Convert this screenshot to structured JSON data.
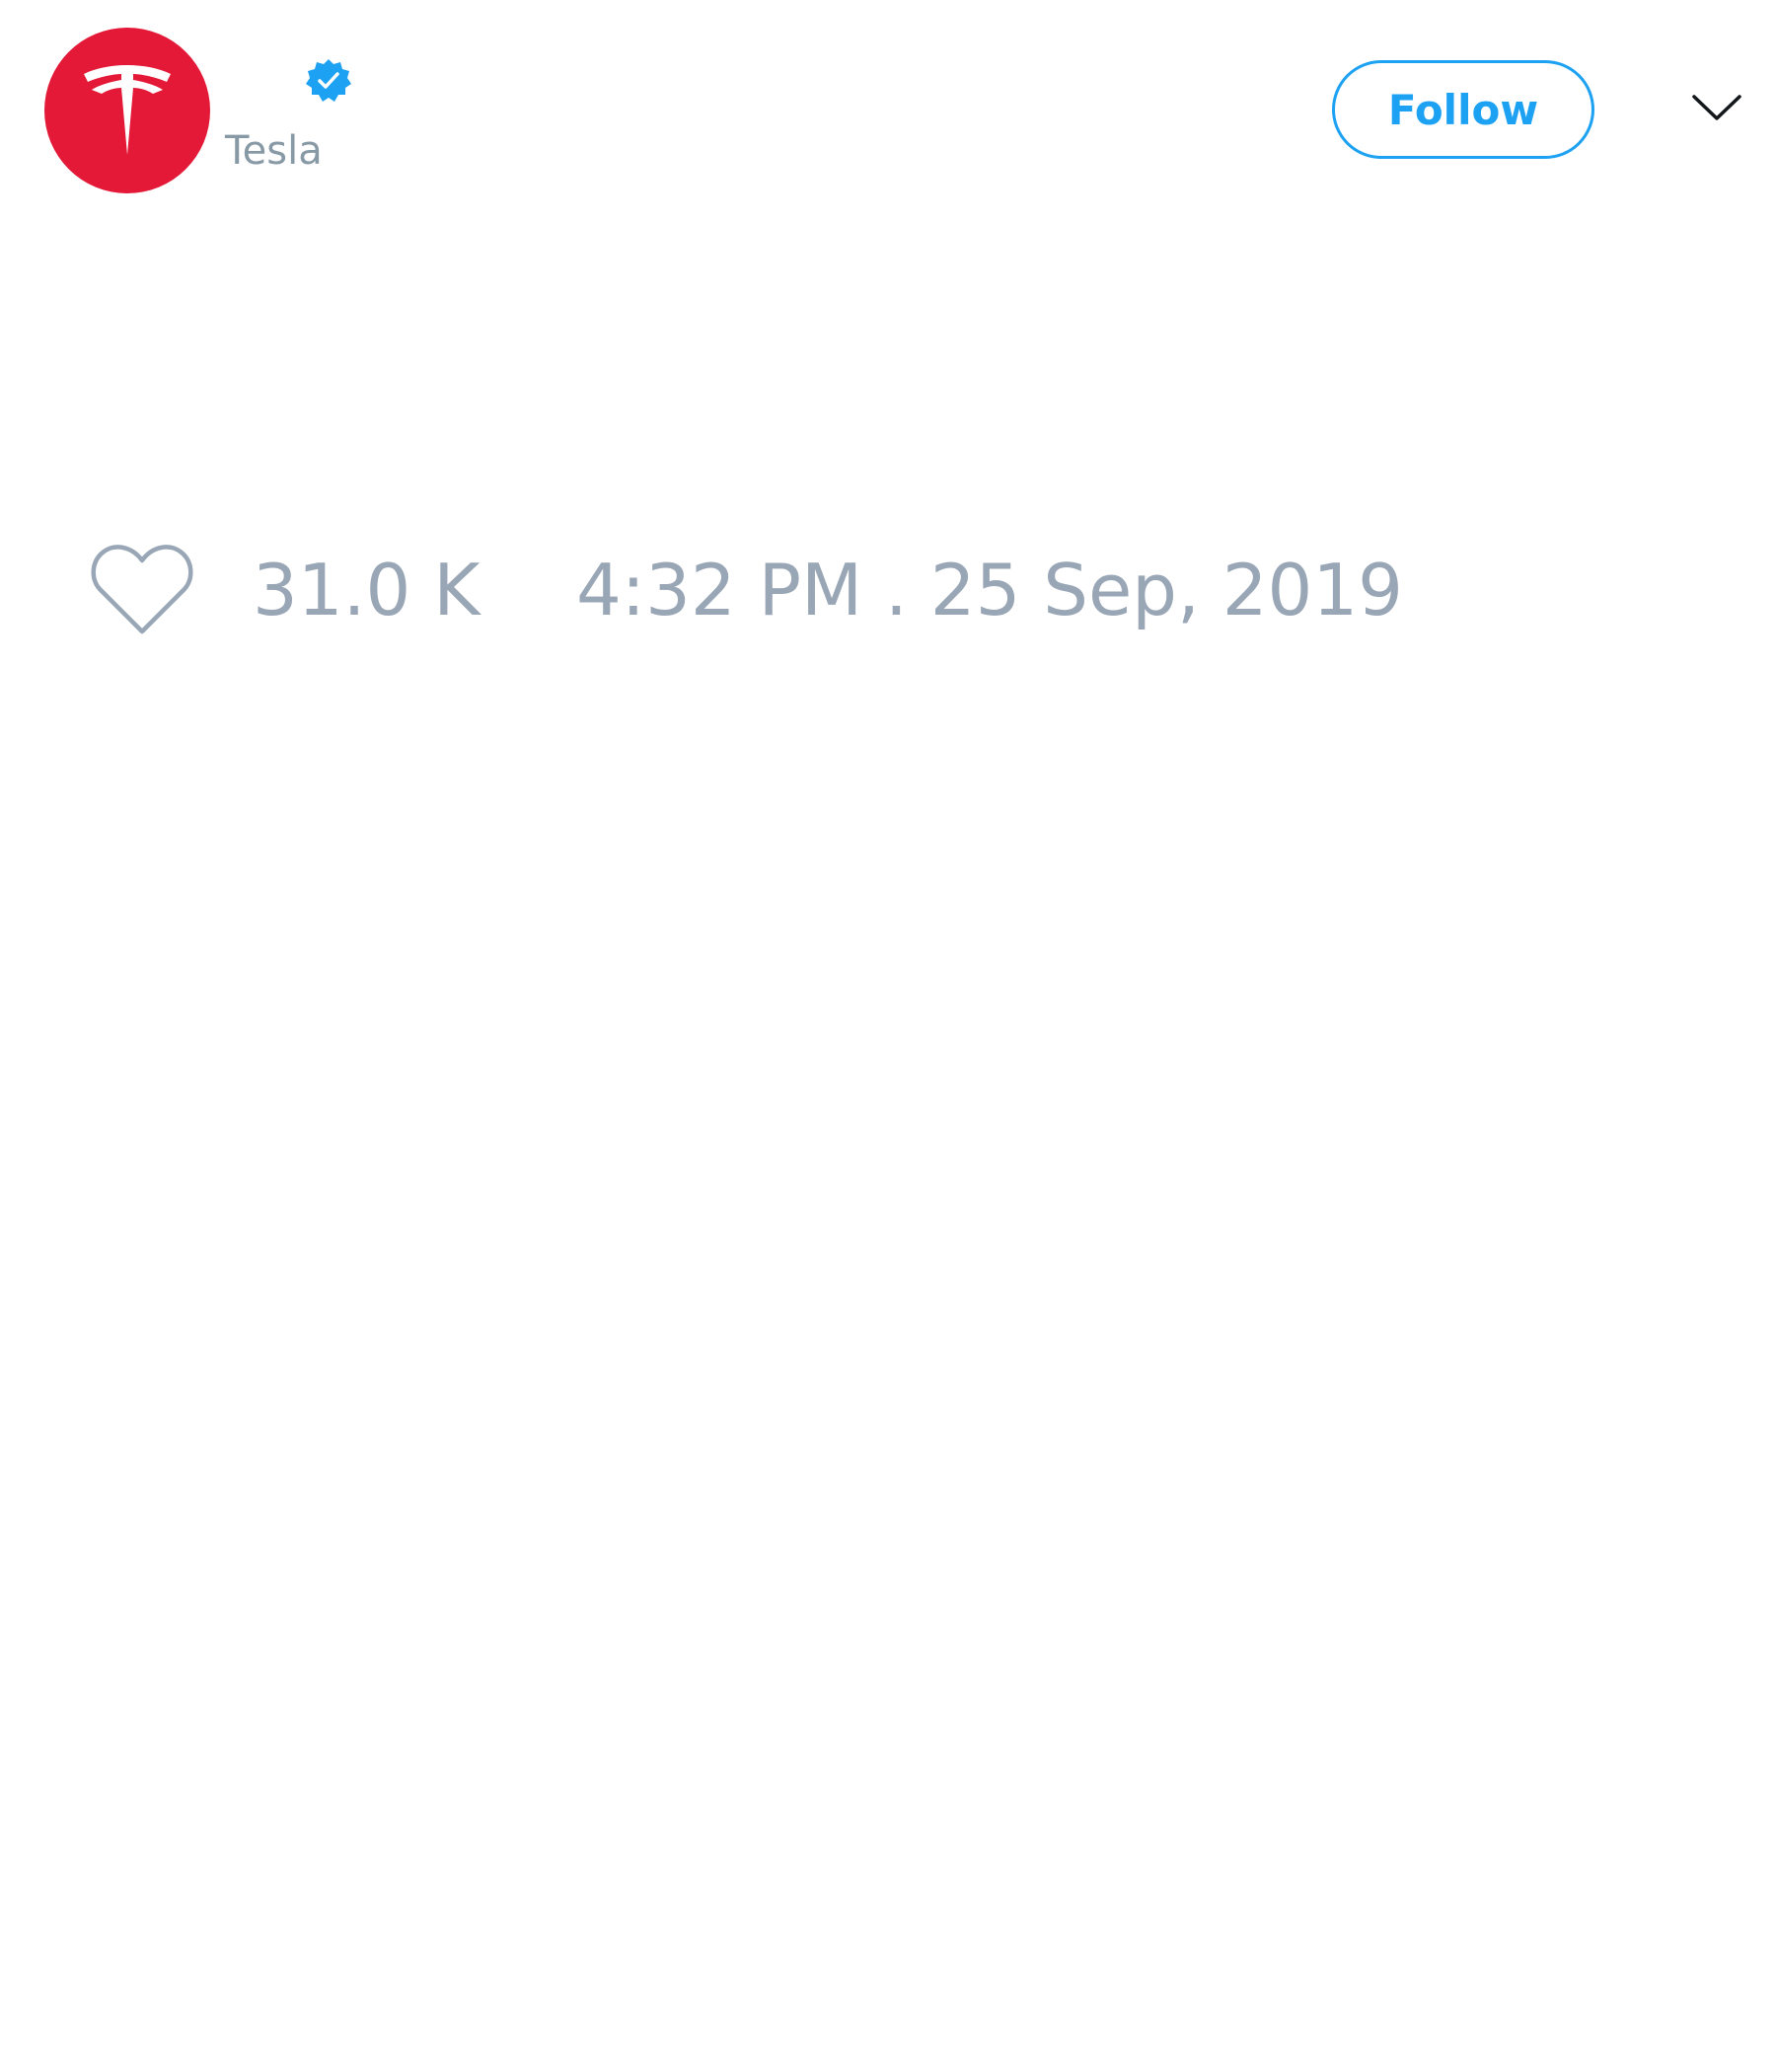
{
  "tweet": {
    "author": {
      "display_name": "",
      "handle": "Tesla",
      "verified": true,
      "avatar_color": "#e31937"
    },
    "follow_label": "Follow",
    "menu_icon": "chevron-down-icon",
    "likes_icon": "heart-icon",
    "likes": "31.0 K",
    "timestamp": "4:32 PM . 25 Sep, 2019"
  },
  "colors": {
    "accent": "#1da1f2",
    "muted": "#99a6b6",
    "brand_red": "#e31937"
  }
}
